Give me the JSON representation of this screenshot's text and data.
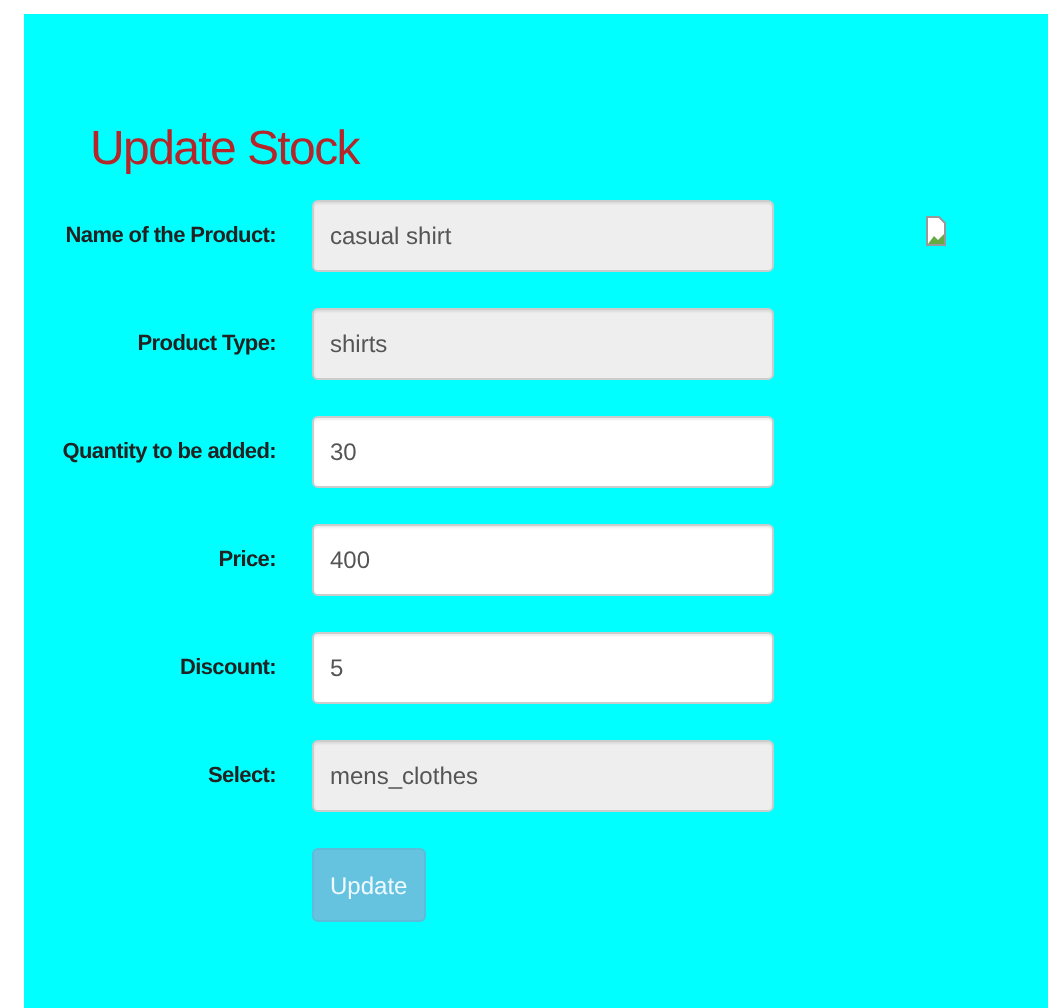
{
  "title": "Update Stock",
  "fields": [
    {
      "label": "Name of the Product:",
      "value": "casual shirt",
      "disabled": true
    },
    {
      "label": "Product Type:",
      "value": "shirts",
      "disabled": true
    },
    {
      "label": "Quantity to be added:",
      "value": "30",
      "disabled": false
    },
    {
      "label": "Price:",
      "value": "400",
      "disabled": false
    },
    {
      "label": "Discount:",
      "value": "5",
      "disabled": false
    },
    {
      "label": "Select:",
      "value": "mens_clothes",
      "disabled": true
    }
  ],
  "button": {
    "label": "Update",
    "disabled": true
  },
  "broken_image": true
}
